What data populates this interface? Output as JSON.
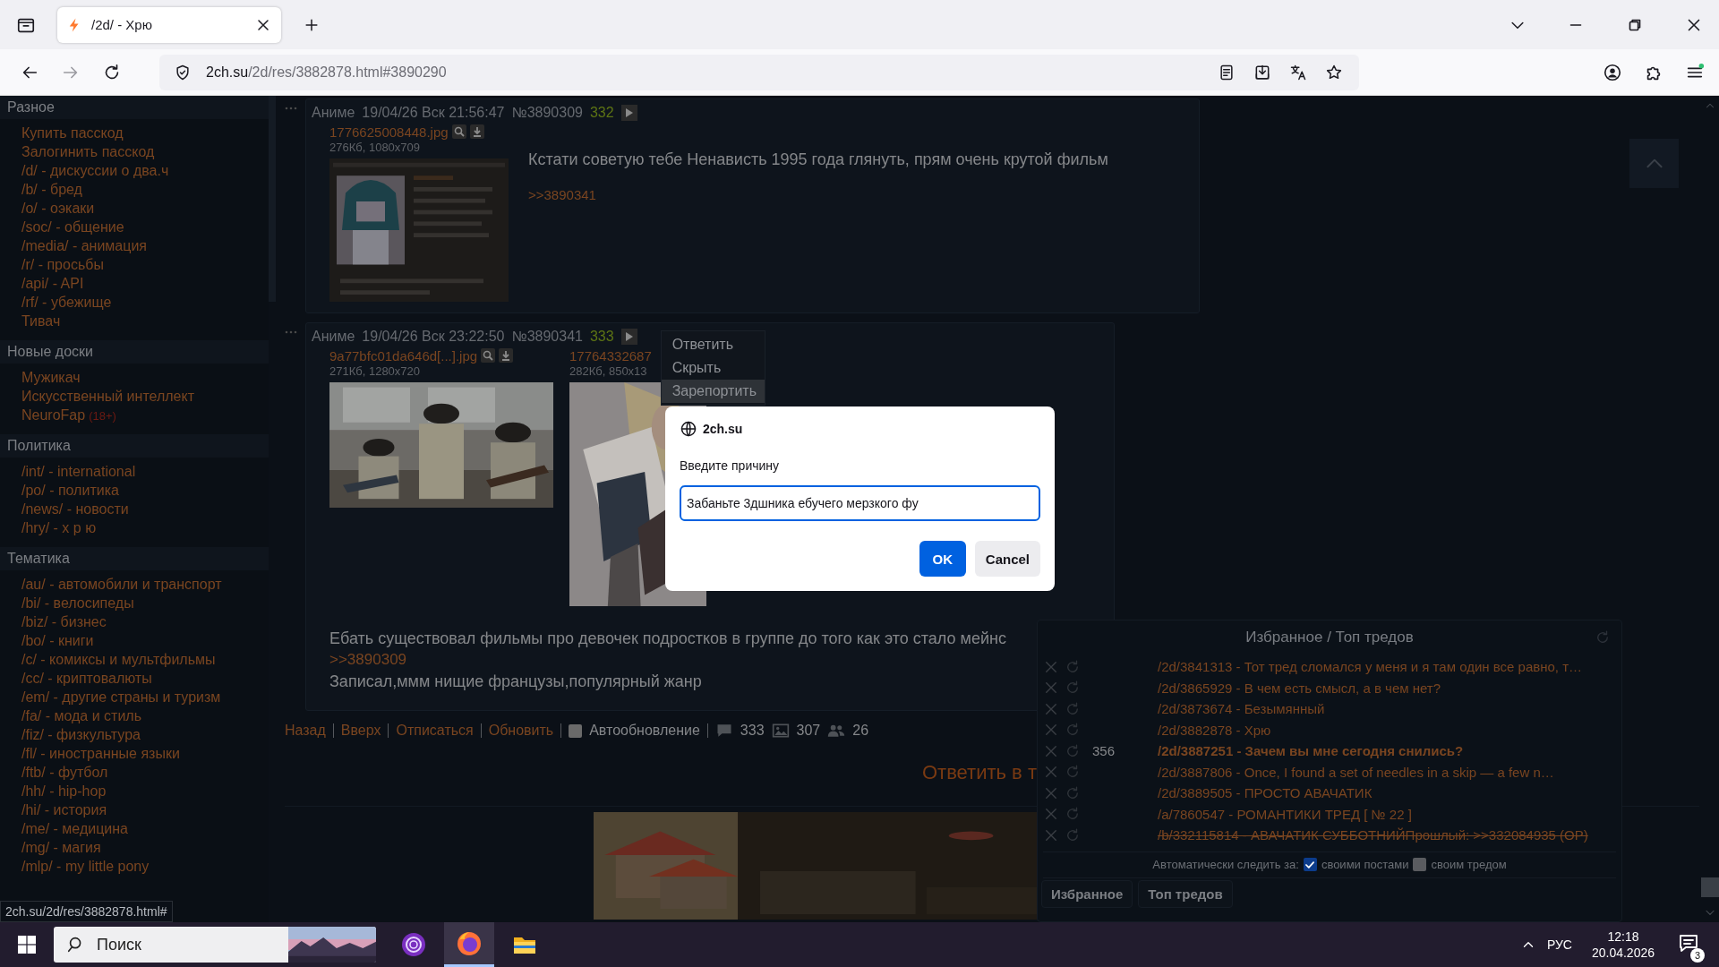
{
  "browser": {
    "tabs": [
      {
        "title": "/2d/ - Хрю",
        "selected": true
      }
    ],
    "address": {
      "host": "2ch.su",
      "path": "/2d/res/3882878.html#3890290"
    }
  },
  "sidebar": {
    "sections": [
      {
        "heading": "Разное",
        "items": [
          {
            "label": "Купить пасскод"
          },
          {
            "label": "Залогинить пасскод"
          },
          {
            "label": "/d/ - дискуссии о два.ч"
          },
          {
            "label": "/b/ - бред"
          },
          {
            "label": "/o/ - оэкаки"
          },
          {
            "label": "/soc/ - общение"
          },
          {
            "label": "/media/ - анимация"
          },
          {
            "label": "/r/ - просьбы"
          },
          {
            "label": "/api/ - API"
          },
          {
            "label": "/rf/ - убежище"
          },
          {
            "label": "Тивач"
          }
        ]
      },
      {
        "heading": "Новые доски",
        "items": [
          {
            "label": "Мужикач"
          },
          {
            "label": "Искусственный интеллект"
          },
          {
            "label": "NeuroFap",
            "tag": "(18+)"
          }
        ]
      },
      {
        "heading": "Политика",
        "items": [
          {
            "label": "/int/ - international"
          },
          {
            "label": "/po/ - политика"
          },
          {
            "label": "/news/ - новости"
          },
          {
            "label": "/hry/ - х р ю"
          }
        ]
      },
      {
        "heading": "Тематика",
        "items": [
          {
            "label": "/au/ - автомобили и транспорт"
          },
          {
            "label": "/bi/ - велосипеды"
          },
          {
            "label": "/biz/ - бизнес"
          },
          {
            "label": "/bo/ - книги"
          },
          {
            "label": "/c/ - комиксы и мультфильмы"
          },
          {
            "label": "/cc/ - криптовалюты"
          },
          {
            "label": "/em/ - другие страны и туризм"
          },
          {
            "label": "/fa/ - мода и стиль"
          },
          {
            "label": "/fiz/ - физкультура"
          },
          {
            "label": "/fl/ - иностранные языки"
          },
          {
            "label": "/ftb/ - футбол"
          },
          {
            "label": "/hh/ - hip-hop"
          },
          {
            "label": "/hi/ - история"
          },
          {
            "label": "/me/ - медицина"
          },
          {
            "label": "/mg/ - магия"
          },
          {
            "label": "/mlp/ - my little pony"
          }
        ]
      }
    ]
  },
  "thread": {
    "posts": [
      {
        "board": "Аниме",
        "datetime": "19/04/26 Вск 21:56:47",
        "number": "№3890309",
        "index": "332",
        "files": [
          {
            "name": "1776625008448.jpg",
            "meta": "276Кб, 1080x709"
          }
        ],
        "body": [
          {
            "kind": "text",
            "text": "Кстати советую тебе Ненависть 1995 года глянуть, прям очень крутой фильм"
          },
          {
            "kind": "gap"
          },
          {
            "kind": "link",
            "text": ">>3890341"
          }
        ]
      },
      {
        "board": "Аниме",
        "datetime": "19/04/26 Вск 23:22:50",
        "number": "№3890341",
        "index": "333",
        "files": [
          {
            "name": "9a77bfc01da646d[...].jpg",
            "meta": "271Кб, 1280x720"
          },
          {
            "name": "17764332687",
            "meta": "282Кб, 850x13"
          }
        ],
        "body": [
          {
            "kind": "text",
            "text": "Ебать существовал фильмы про девочек подростков в группе до того как это стало мейнс"
          },
          {
            "kind": "link",
            "text": ">>3890309"
          },
          {
            "kind": "text",
            "text": "Записал,ммм нищие французы,популярный жанр"
          }
        ],
        "menu": [
          {
            "label": "Ответить",
            "selected": false
          },
          {
            "label": "Скрыть",
            "selected": false
          },
          {
            "label": "Зарепортить",
            "selected": true
          }
        ]
      }
    ],
    "footer": {
      "links": [
        "Назад",
        "Вверх",
        "Отписаться",
        "Обновить"
      ],
      "autoupdate": {
        "label": "Автообновление",
        "checked": false
      },
      "stats": {
        "posts": "333",
        "images": "307",
        "posters": "26"
      }
    },
    "reply_link": "Ответить в т"
  },
  "dialog": {
    "origin": "2ch.su",
    "prompt": "Введите причину",
    "value": "Забаньте 3дшника ебучего мерзкого фу",
    "buttons": [
      {
        "label": "OK",
        "kind": "primary"
      },
      {
        "label": "Cancel",
        "kind": "secondary"
      }
    ]
  },
  "favorites": {
    "title": "Избранное / Топ тредов",
    "rows": [
      {
        "label": "/2d/3841313 - Тот тред сломался у меня и я там один все равно, т…",
        "unread": false,
        "dead": false
      },
      {
        "label": "/2d/3865929 - В чем есть смысл, а в чем нет?",
        "unread": false,
        "dead": false
      },
      {
        "label": "/2d/3873674 - Безымянный",
        "unread": false,
        "dead": false
      },
      {
        "label": "/2d/3882878 - Хрю",
        "unread": false,
        "dead": false
      },
      {
        "count": "356",
        "label": "/2d/3887251 - Зачем вы мне сегодня снились?",
        "unread": true,
        "dead": false
      },
      {
        "label": "/2d/3887806 - Once, I found a set of needles in a skip — a few n…",
        "unread": false,
        "dead": false
      },
      {
        "label": "/2d/3889505 - ПРОСТО АВАЧАТИК",
        "unread": false,
        "dead": false
      },
      {
        "label": "/a/7860547 - РОМАНТИКИ ТРЕД [ № 22 ]",
        "unread": false,
        "dead": false
      },
      {
        "label": "/b/332115814 - АВАЧАТИК СУББОТНИЙПрошлый: >>332084935 (OP)",
        "unread": false,
        "dead": true
      }
    ],
    "auto_follow": {
      "label": "Автоматически следить за:",
      "options": [
        {
          "label": "своими постами",
          "checked": true
        },
        {
          "label": "своим тредом",
          "checked": false
        }
      ]
    },
    "tabs": [
      "Избранное",
      "Топ тредов"
    ]
  },
  "status_url": "2ch.su/2d/res/3882878.html#",
  "taskbar": {
    "search": {
      "placeholder": "Поиск"
    },
    "apps": [
      {
        "kind": "orb",
        "active": false
      },
      {
        "kind": "firefox",
        "active": true
      },
      {
        "kind": "folder",
        "active": false
      }
    ],
    "language": "РУС",
    "time": "12:18",
    "date": "20.04.2026",
    "notifications": "3"
  }
}
